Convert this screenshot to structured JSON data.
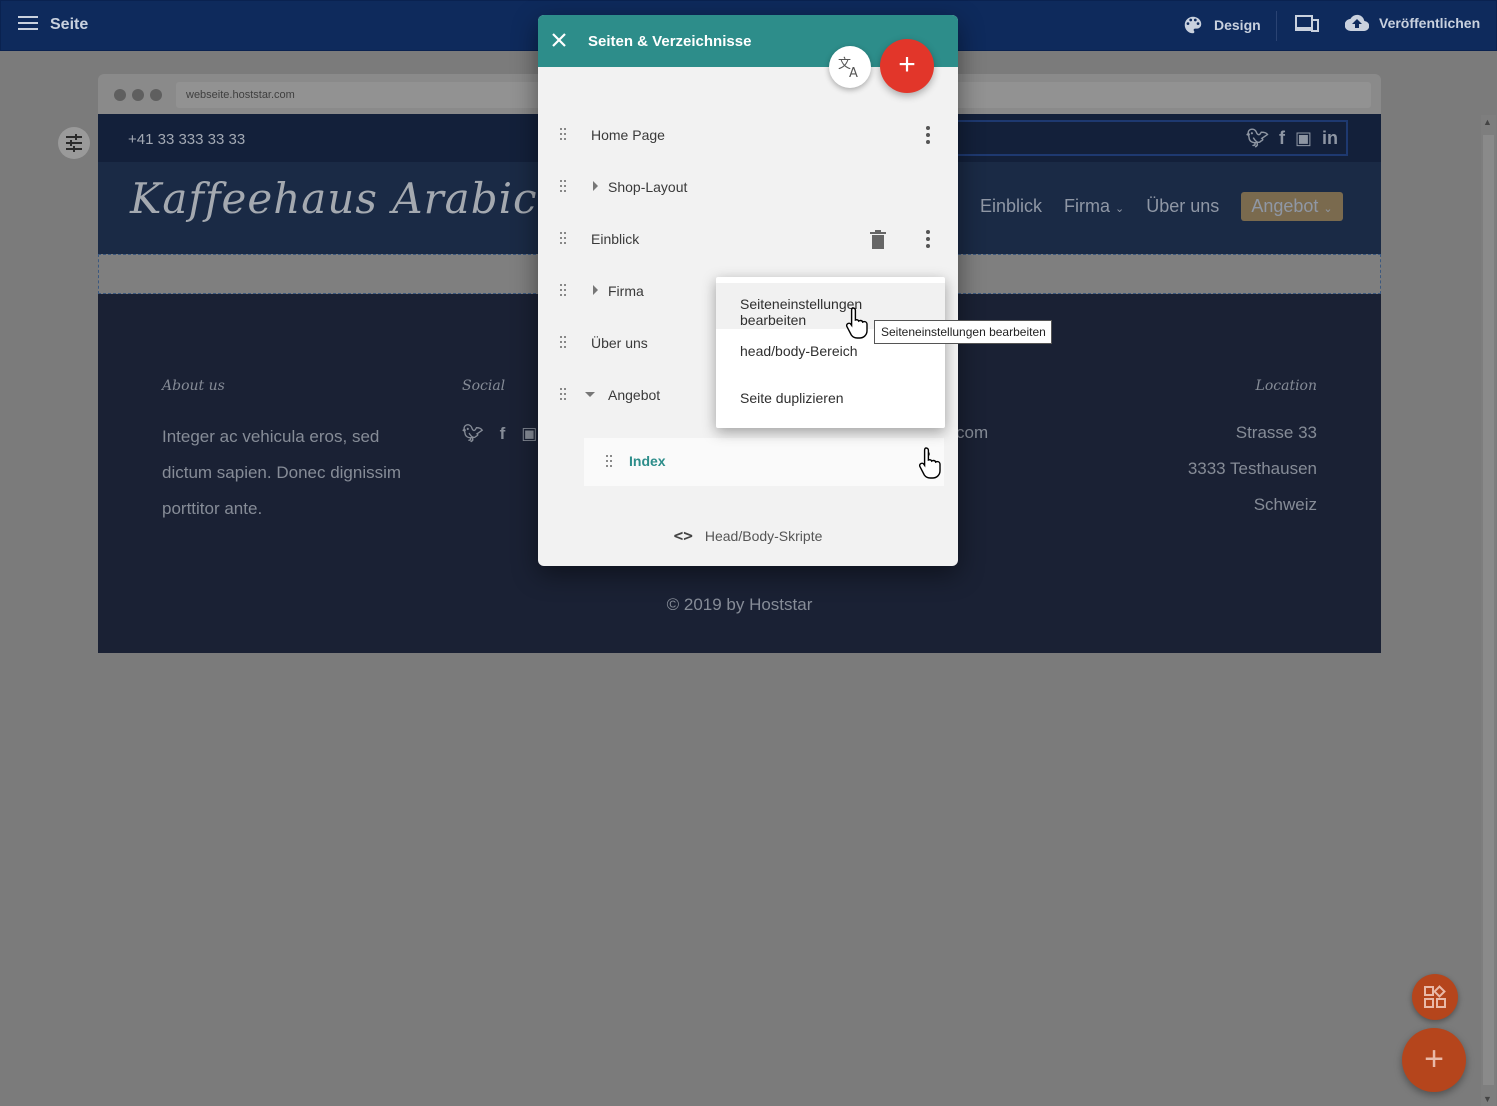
{
  "topbar": {
    "title": "Seite",
    "menu_icon": "hamburger-icon",
    "design_label": "Design",
    "publish_label": "Veröffentlichen",
    "colors": {
      "background": "#0e2a5c",
      "text": "#c9d1de"
    }
  },
  "browser": {
    "url": "webseite.hoststar.com"
  },
  "site": {
    "phone": "+41 33 333 33 33",
    "logo": "Kaffeehaus Arabica",
    "nav": [
      {
        "label": "Einblick"
      },
      {
        "label": "Firma"
      },
      {
        "label": "Über uns"
      },
      {
        "label": "Angebot",
        "active": true
      }
    ],
    "footer": {
      "about_heading": "About us",
      "about_text_lines": [
        "Integer ac vehicula eros, sed",
        "dictum sapien. Donec dignissim",
        "porttitor ante."
      ],
      "social_heading": "Social",
      "email_fragment": "com",
      "location_heading": "Location",
      "location_lines": [
        "Strasse 33",
        "3333 Testhausen",
        "Schweiz"
      ],
      "copyright": "© 2019 by Hoststar"
    },
    "colors": {
      "header": "#1a2a45",
      "footer": "#1a2134",
      "active_nav": "#7a6a4e"
    }
  },
  "dialog": {
    "title": "Seiten & Verzeichnisse",
    "accent_color": "#2d8d8a",
    "add_color": "#e2362a",
    "pages": [
      {
        "label": "Home Page",
        "expandable": false
      },
      {
        "label": "Shop-Layout",
        "expandable": true,
        "expanded": false
      },
      {
        "label": "Einblick",
        "expandable": false
      },
      {
        "label": "Firma",
        "expandable": true,
        "expanded": false
      },
      {
        "label": "Über uns",
        "expandable": false
      },
      {
        "label": "Angebot",
        "expandable": true,
        "expanded": true
      }
    ],
    "subpage": {
      "label": "Index",
      "selected": true
    },
    "scripts_label": "Head/Body-Skripte"
  },
  "context_menu": {
    "items": [
      {
        "label": "Seiteneinstellungen bearbeiten",
        "hovered": true
      },
      {
        "label": "head/body-Bereich"
      },
      {
        "label": "Seite duplizieren"
      }
    ]
  },
  "tooltip": "Seiteneinstellungen bearbeiten",
  "fab": {
    "color": "#b5451c"
  }
}
